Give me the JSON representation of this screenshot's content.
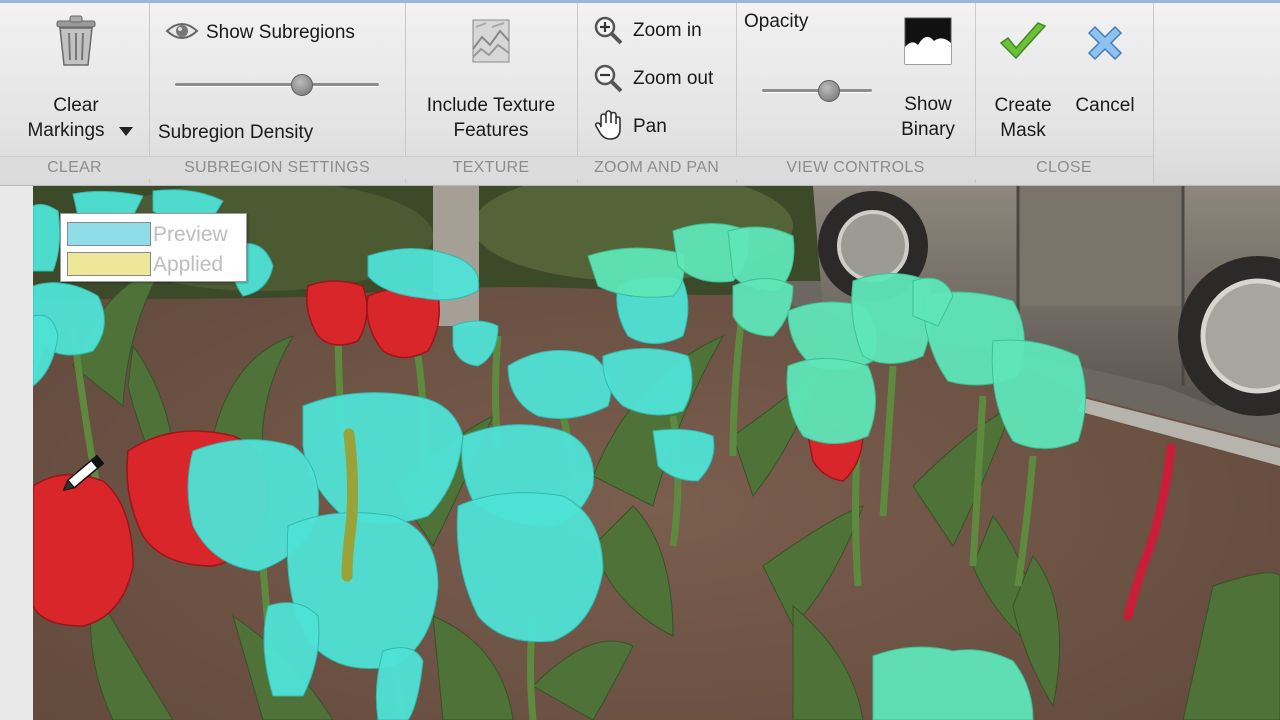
{
  "ribbon": {
    "clear": {
      "button_line1": "Clear",
      "button_line2": "Markings",
      "group": "CLEAR"
    },
    "subregion": {
      "show_label": "Show Subregions",
      "density_label": "Subregion Density",
      "density_level": 0.62,
      "group": "SUBREGION SETTINGS"
    },
    "texture": {
      "line1": "Include Texture",
      "line2": "Features",
      "group": "TEXTURE"
    },
    "zoom": {
      "zoom_in": "Zoom in",
      "zoom_out": "Zoom out",
      "pan": "Pan",
      "group": "ZOOM AND PAN"
    },
    "view": {
      "opacity_label": "Opacity",
      "opacity_level": 0.6,
      "binary_line1": "Show",
      "binary_line2": "Binary",
      "group": "VIEW CONTROLS"
    },
    "close": {
      "create_line1": "Create",
      "create_line2": "Mask",
      "cancel": "Cancel",
      "group": "CLOSE"
    }
  },
  "legend": {
    "preview": "Preview",
    "applied": "Applied",
    "preview_color": "#8fdde8",
    "applied_color": "#eee79a"
  },
  "colors": {
    "overlay_cyan": "#4ee3d6",
    "overlay_green": "#5ee6b8",
    "red_tulip": "#d9262a",
    "mark_yellow": "#9aa23a",
    "mark_red": "#c81e3a"
  }
}
